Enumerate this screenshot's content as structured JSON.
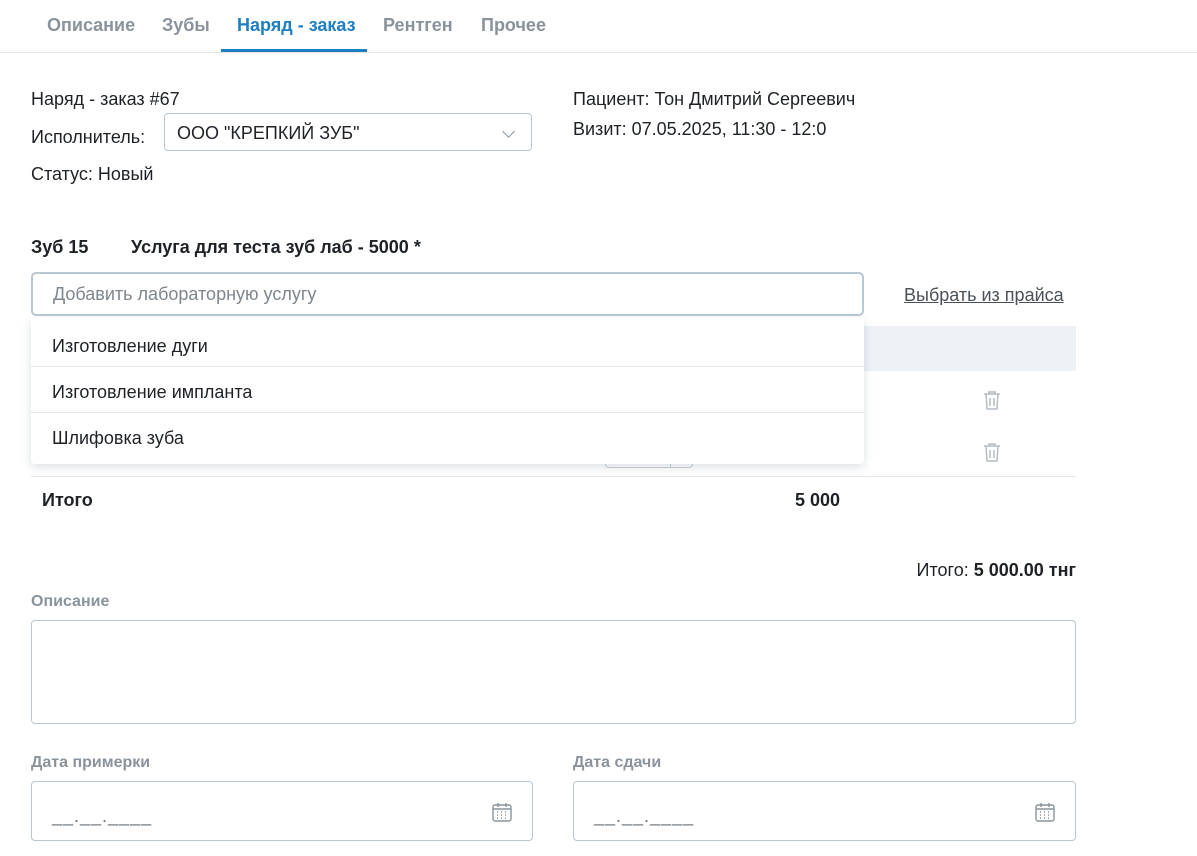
{
  "tabs": [
    {
      "label": "Описание",
      "active": false
    },
    {
      "label": "Зубы",
      "active": false
    },
    {
      "label": "Наряд - заказ",
      "active": true
    },
    {
      "label": "Рентген",
      "active": false
    },
    {
      "label": "Прочее",
      "active": false
    }
  ],
  "order": {
    "title": "Наряд - заказ #67",
    "executor_label": "Исполнитель:",
    "executor_value": "ООО \"КРЕПКИЙ ЗУБ\"",
    "status": "Статус: Новый",
    "patient": "Пациент: Тон Дмитрий Сергеевич",
    "visit": "Визит: 07.05.2025, 11:30 - 12:0"
  },
  "tooth": {
    "tooth_label": "Зуб 15",
    "service_label": "Услуга для теста зуб лаб - 5000 *",
    "search_placeholder": "Добавить лабораторную услугу",
    "price_link": "Выбрать из прайса",
    "dropdown_options": [
      "Изготовление дуги",
      "Изготовление импланта",
      "Шлифовка зуба"
    ],
    "total_label": "Итого",
    "total_value": "5 000"
  },
  "summary": {
    "label": "Итого:",
    "value": "5 000.00 тнг"
  },
  "description_label": "Описание",
  "fitting_date_label": "Дата примерки",
  "delivery_date_label": "Дата сдачи",
  "date_mask": "__.__.____",
  "colors": {
    "accent": "#1f7ec1",
    "muted": "#8a939c",
    "border": "#b9c7d3"
  }
}
